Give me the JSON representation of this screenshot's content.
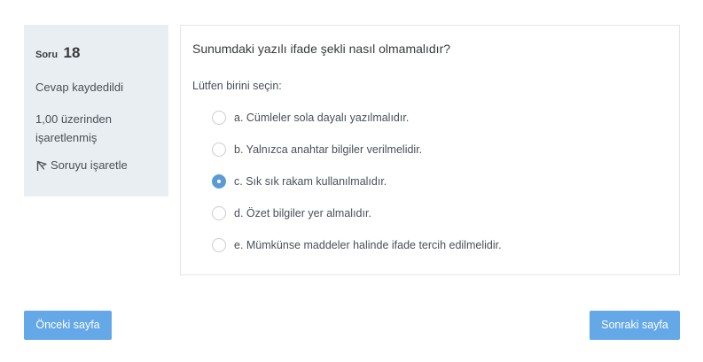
{
  "question_info": {
    "number_label": "Soru",
    "number": "18",
    "state": "Cevap kaydedildi",
    "grade": "1,00 üzerinden işaretlenmiş",
    "flag_label": "Soruyu işaretle",
    "flag_icon": "flag-icon"
  },
  "question": {
    "text": "Sunumdaki yazılı ifade şekli nasıl olmamalıdır?",
    "prompt": "Lütfen birini seçin:",
    "answers": [
      {
        "label": "a. Cümleler sola dayalı yazılmalıdır.",
        "selected": false
      },
      {
        "label": "b. Yalnızca anahtar bilgiler verilmelidir.",
        "selected": false
      },
      {
        "label": "c. Sık sık rakam kullanılmalıdır.",
        "selected": true
      },
      {
        "label": "d. Özet bilgiler yer almalıdır.",
        "selected": false
      },
      {
        "label": "e. Mümkünse maddeler halinde ifade tercih edilmelidir.",
        "selected": false
      }
    ]
  },
  "navigation": {
    "prev_label": "Önceki sayfa",
    "next_label": "Sonraki sayfa"
  },
  "colors": {
    "accent": "#65a8e8",
    "radio_selected": "#5b9bd5",
    "panel_bg": "#e9eef2"
  }
}
